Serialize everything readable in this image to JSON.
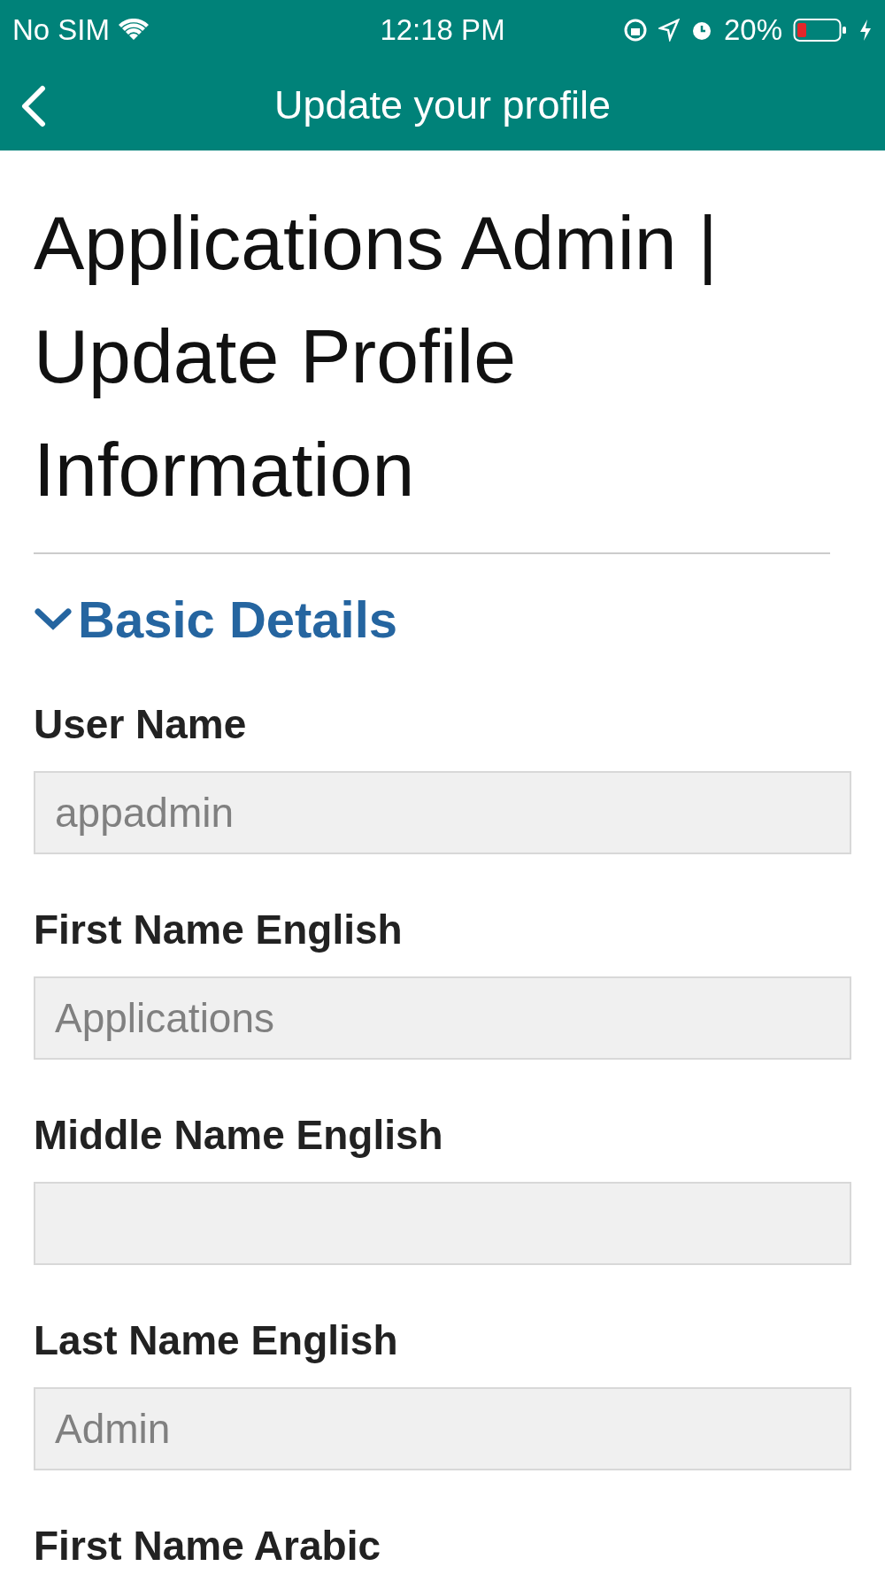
{
  "status_bar": {
    "carrier": "No SIM",
    "time": "12:18 PM",
    "battery": "20%"
  },
  "nav_bar": {
    "title": "Update your profile"
  },
  "page": {
    "heading": "Applications Admin | Update Profile Information"
  },
  "section": {
    "title": "Basic Details",
    "expanded": true,
    "fields": [
      {
        "label": "User Name",
        "value": "appadmin",
        "disabled": true
      },
      {
        "label": "First Name English",
        "value": "Applications",
        "disabled": true
      },
      {
        "label": "Middle Name English",
        "disabled": true
      },
      {
        "label": "Last Name English",
        "value": "Admin",
        "disabled": true
      },
      {
        "label": "First Name Arabic"
      }
    ]
  }
}
